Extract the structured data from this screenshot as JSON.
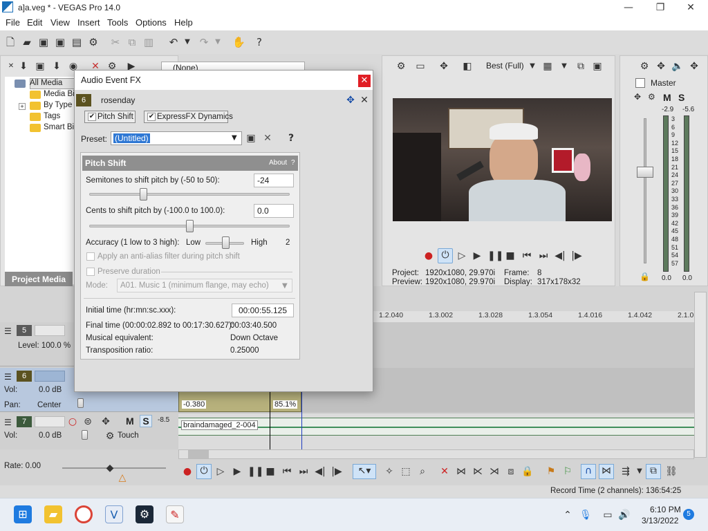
{
  "window": {
    "title": "a]a.veg * - VEGAS Pro 14.0"
  },
  "menu": [
    "File",
    "Edit",
    "View",
    "Insert",
    "Tools",
    "Options",
    "Help"
  ],
  "media": {
    "tree": [
      "All Media",
      "Media Bin",
      "By Type",
      "Tags",
      "Smart Bin"
    ],
    "tab": "Project Media",
    "fx_dropdown": "(None)"
  },
  "dialog": {
    "title": "Audio Event FX",
    "event_number": "6",
    "event_name": "rosenday",
    "chain": [
      "Pitch Shift",
      "ExpressFX Dynamics"
    ],
    "preset_label": "Preset:",
    "preset_value": "(Untitled)",
    "plugin_name": "Pitch Shift",
    "about": "About",
    "semitones_label": "Semitones to shift pitch by (-50 to 50):",
    "semitones_value": "-24",
    "semitones_norm": 0.26,
    "cents_label": "Cents to shift pitch by (-100.0 to 100.0):",
    "cents_value": "0.0",
    "cents_norm": 0.5,
    "accuracy_label": "Accuracy (1 low to 3 high):",
    "accuracy_low": "Low",
    "accuracy_high": "High",
    "accuracy_value": "2",
    "antialias_label": "Apply an anti-alias filter during pitch shift",
    "preserve_label": "Preserve duration",
    "mode_label": "Mode:",
    "mode_value": "A01. Music 1 (minimum flange, may echo)",
    "initial_time_label": "Initial time (hr:mn:sc.xxx):",
    "initial_time_value": "00:00:55.125",
    "final_time_label": "Final time (00:00:02.892 to 00:17:30.627):",
    "final_time_value": "00:03:40.500",
    "musical_label": "Musical equivalent:",
    "musical_value": "Down Octave",
    "ratio_label": "Transposition ratio:",
    "ratio_value": "0.25000"
  },
  "preview": {
    "quality": "Best (Full)",
    "project_label": "Project:",
    "project_value": "1920x1080, 29.970i",
    "preview_label": "Preview:",
    "preview_value": "1920x1080, 29.970i",
    "frame_label": "Frame:",
    "frame_value": "8",
    "display_label": "Display:",
    "display_value": "317x178x32"
  },
  "master": {
    "title": "Master",
    "peak_left": "-2.9",
    "peak_right": "-5.6",
    "scale": [
      "3",
      "6",
      "9",
      "12",
      "15",
      "18",
      "21",
      "24",
      "27",
      "30",
      "33",
      "36",
      "39",
      "42",
      "45",
      "48",
      "51",
      "54",
      "57"
    ],
    "bottom_left": "0.0",
    "bottom_right": "0.0"
  },
  "timeline": {
    "ruler": [
      "1.2.040",
      "1.3.002",
      "1.3.028",
      "1.3.054",
      "1.4.016",
      "1.4.042",
      "2.1.0"
    ],
    "tracks": [
      {
        "num": "5",
        "level": "Level: 100.0 %"
      },
      {
        "num": "6",
        "vol_label": "Vol:",
        "vol": "0.0 dB",
        "pan_label": "Pan:",
        "pan": "Center",
        "clip_left": "-0.380",
        "clip_right": "85.1%"
      },
      {
        "num": "7",
        "vol_label": "Vol:",
        "vol": "0.0 dB",
        "touch": "Touch",
        "clip_name": "braindamaged_2-004",
        "meter": "-8.5"
      }
    ],
    "rate": "Rate: 0.00",
    "record_time": "Record Time (2 channels): 136:54:25"
  },
  "taskbar": {
    "time": "6:10 PM",
    "date": "3/13/2022",
    "badge": "5"
  }
}
